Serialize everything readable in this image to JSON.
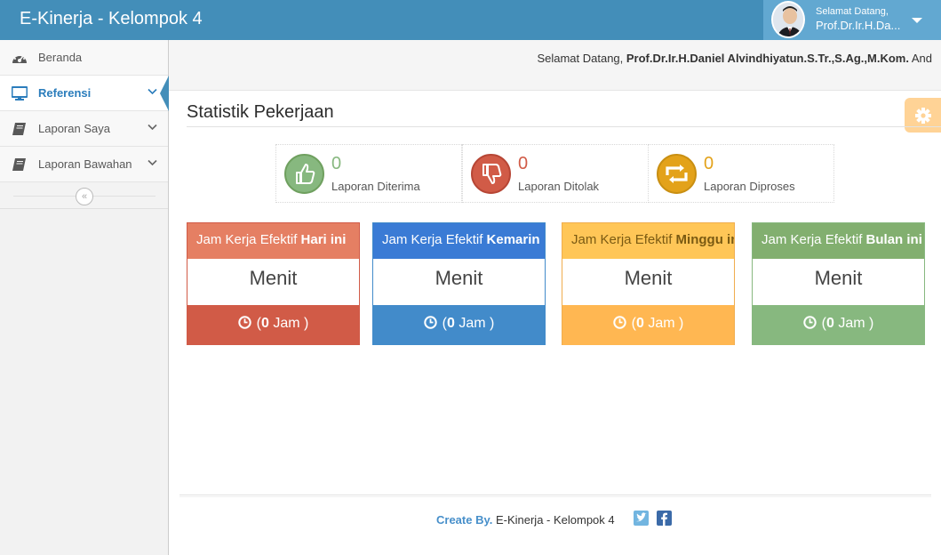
{
  "app": {
    "title": "E-Kinerja - Kelompok 4"
  },
  "user_menu": {
    "greeting": "Selamat Datang,",
    "name": "Prof.Dr.Ir.H.Da..."
  },
  "sidebar": {
    "items": [
      {
        "label": "Beranda",
        "icon": "dashboard-icon",
        "active": false,
        "has_submenu": false
      },
      {
        "label": "Referensi",
        "icon": "desktop-icon",
        "active": true,
        "has_submenu": true
      },
      {
        "label": "Laporan Saya",
        "icon": "book-icon",
        "active": false,
        "has_submenu": true
      },
      {
        "label": "Laporan Bawahan",
        "icon": "book-icon",
        "active": false,
        "has_submenu": true
      }
    ],
    "collapse_glyph": "«"
  },
  "breadcrumb": {
    "welcome_prefix": "Selamat Datang, ",
    "welcome_name": "Prof.Dr.Ir.H.Daniel Alvindhiyatun.S.Tr.,S.Ag.,M.Kom.",
    "welcome_suffix": " And"
  },
  "page": {
    "title": "Statistik Pekerjaan"
  },
  "infoboxes": [
    {
      "value": "0",
      "caption": "Laporan Diterima",
      "icon": "thumbs-up-icon",
      "color": "#87b87f"
    },
    {
      "value": "0",
      "caption": "Laporan Ditolak",
      "icon": "thumbs-down-icon",
      "color": "#d15b47"
    },
    {
      "value": "0",
      "caption": "Laporan Diproses",
      "icon": "retweet-icon",
      "color": "#e3a21a"
    }
  ],
  "cards": [
    {
      "head_prefix": "Jam Kerja Efektif ",
      "head_bold": "Hari ini",
      "body": "Menit",
      "foot_open": "(",
      "foot_value": "0",
      "foot_unit": " Jam )",
      "head_color": "#e57f63",
      "foot_color": "#d15b47",
      "border_color": "#d15b47"
    },
    {
      "head_prefix": "Jam Kerja Efektif ",
      "head_bold": "Kemarin",
      "body": "Menit",
      "foot_open": "(",
      "foot_value": "0",
      "foot_unit": " Jam )",
      "head_color": "#3a7bd5",
      "foot_color": "#428bca",
      "border_color": "#428bca"
    },
    {
      "head_prefix": "Jam Kerja Efektif ",
      "head_bold": "Minggu ini",
      "body": "Menit",
      "foot_open": "(",
      "foot_value": "0",
      "foot_unit": " Jam )",
      "head_color": "#ffc657",
      "foot_color": "#ffb752",
      "border_color": "#f0ad4e"
    },
    {
      "head_prefix": "Jam Kerja Efektif ",
      "head_bold": "Bulan ini",
      "body": "Menit",
      "foot_open": "(",
      "foot_value": "0",
      "foot_unit": " Jam )",
      "head_color": "#82af6f",
      "foot_color": "#87b87f",
      "border_color": "#87b87f"
    }
  ],
  "footer": {
    "create_by": "Create By.",
    "text": " E-Kinerja - Kelompok 4"
  },
  "colors": {
    "navbar": "#438eb9",
    "usermenu": "#62a8d1",
    "accent": "#2b7dbc"
  }
}
